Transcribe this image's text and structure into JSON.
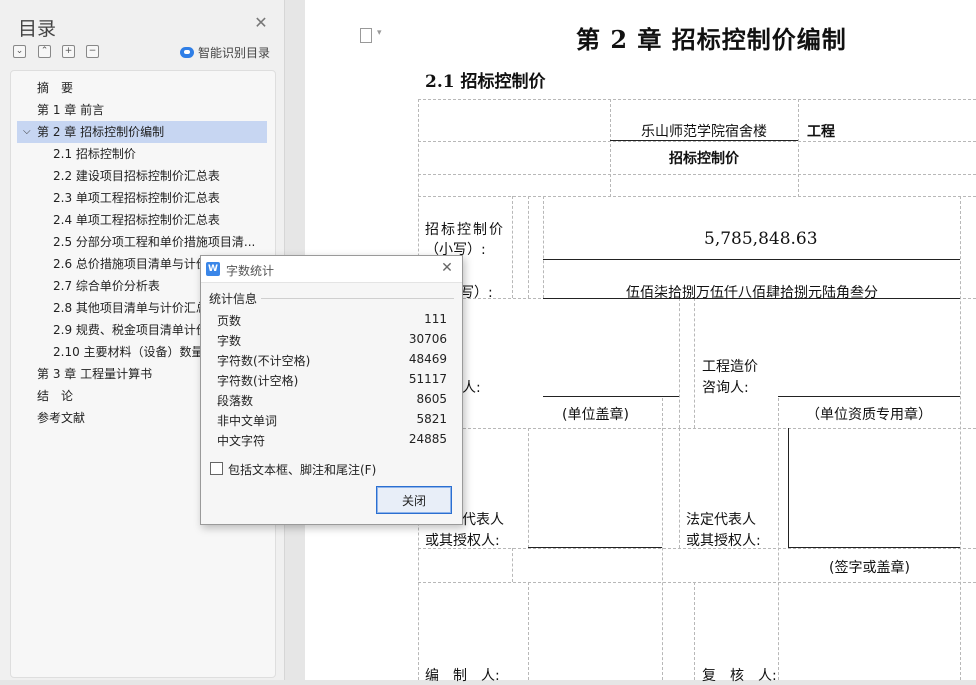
{
  "toc": {
    "title": "目录",
    "ai_label": "智能识别目录",
    "items": [
      {
        "label": "摘　要",
        "level": 1
      },
      {
        "label": "第 1 章  前言",
        "level": 1
      },
      {
        "label": "第 2 章  招标控制价编制",
        "level": 1,
        "expanded": true,
        "selected": true
      },
      {
        "label": "2.1 招标控制价",
        "level": 2
      },
      {
        "label": "2.2 建设项目招标控制价汇总表",
        "level": 2
      },
      {
        "label": "2.3 单项工程招标控制价汇总表",
        "level": 2
      },
      {
        "label": "2.4 单项工程招标控制价汇总表",
        "level": 2
      },
      {
        "label": "2.5 分部分项工程和单价措施项目清...",
        "level": 2
      },
      {
        "label": "2.6 总价措施项目清单与计价",
        "level": 2
      },
      {
        "label": "2.7 综合单价分析表",
        "level": 2
      },
      {
        "label": "2.8 其他项目清单与计价汇总",
        "level": 2
      },
      {
        "label": "2.9 规费、税金项目清单计价",
        "level": 2
      },
      {
        "label": "2.10 主要材料（设备）数量",
        "level": 2
      },
      {
        "label": "第 3 章  工程量计算书",
        "level": 1
      },
      {
        "label": "结　论",
        "level": 1
      },
      {
        "label": "参考文献",
        "level": 1
      }
    ]
  },
  "doc": {
    "chapter_title": "第 2 章  招标控制价编制",
    "section_title": "2.1 招标控制价",
    "project_name": "乐山师范学院宿舍楼",
    "project_suffix": "工程",
    "form_title": "招标控制价",
    "price_label_line1": "招标控制价",
    "price_label_line2": "（小写）:",
    "price_number": "5,785,848.63",
    "price_upper_label": "写）:",
    "price_upper_value": "伍佰柒拾捌万伍仟八佰肆拾捌元陆角叁分",
    "bidder_label_tail": "人:",
    "consultant_label_line1": "工程造价",
    "consultant_label_line2": "咨询人:",
    "unit_seal": "(单位盖章)",
    "qual_seal": "（单位资质专用章）",
    "legal_rep_left_line1": "代表人",
    "legal_rep_left_line2": "或其授权人:",
    "legal_rep_right_line1": "法定代表人",
    "legal_rep_right_line2": "或其授权人:",
    "sign_seal": "(签字或盖章)",
    "preparer_label": "编　制　人:",
    "reviewer_label": "复　核　人:"
  },
  "dialog": {
    "title": "字数统计",
    "section": "统计信息",
    "stats": [
      {
        "label": "页数",
        "value": "111"
      },
      {
        "label": "字数",
        "value": "30706"
      },
      {
        "label": "字符数(不计空格)",
        "value": "48469"
      },
      {
        "label": "字符数(计空格)",
        "value": "51117"
      },
      {
        "label": "段落数",
        "value": "8605"
      },
      {
        "label": "非中文单词",
        "value": "5821"
      },
      {
        "label": "中文字符",
        "value": "24885"
      }
    ],
    "checkbox_label": "包括文本框、脚注和尾注(F)",
    "checkbox_checked": false,
    "close_label": "关闭"
  },
  "colors": {
    "selected_bg": "#c7d6f2",
    "accent": "#2b6fd1"
  }
}
